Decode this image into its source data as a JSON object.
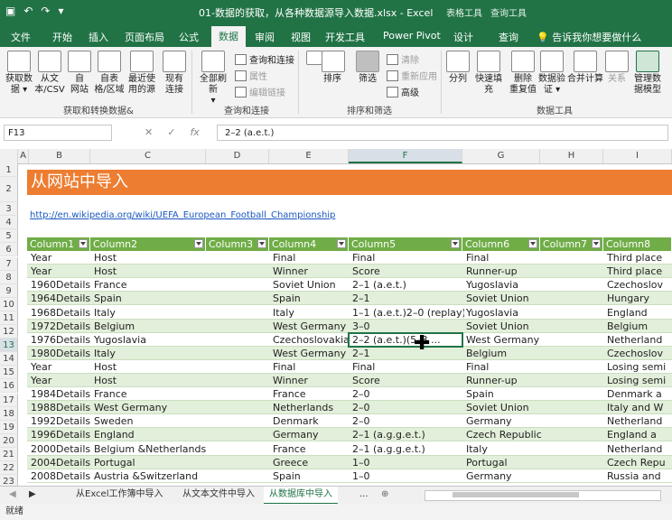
{
  "titlebar": {
    "title": "01-数据的获取，从各种数据源导入数据.xlsx  -  Excel",
    "ctx_tab1": "表格工具",
    "ctx_tab2": "查询工具"
  },
  "tabs": [
    "文件",
    "开始",
    "插入",
    "页面布局",
    "公式",
    "数据",
    "审阅",
    "视图",
    "开发工具",
    "Power Pivot",
    "设计",
    "查询"
  ],
  "tell_me": "告诉我你想要做什么",
  "ribbon": {
    "get_data": "获取数\n据 ▾",
    "from_text": "从文\n本/CSV",
    "from_web": "自\n网站",
    "from_table": "自表\n格/区域",
    "recent": "最近使\n用的源",
    "existing": "现有\n连接",
    "group_get": "获取和转换数据&",
    "refresh_all": "全部刷新\n▾",
    "queries_conn": "查询和连接",
    "properties": "属性",
    "edit_links": "编辑链接",
    "group_query": "查询和连接",
    "sort": "排序",
    "filter": "筛选",
    "clear": "清除",
    "reapply": "重新应用",
    "advanced": "高级",
    "group_sort": "排序和筛选",
    "split": "分列",
    "flash": "快速填充",
    "remove_dup": "删除\n重复值",
    "validate": "数据验\n证 ▾",
    "consolidate": "合并计算",
    "relations": "关系",
    "model": "管理数\n据模型",
    "group_tools": "数据工具"
  },
  "formula_bar": {
    "cell_ref": "F13",
    "value": "2–2 (a.e.t.)"
  },
  "columns": [
    "A",
    "B",
    "C",
    "D",
    "E",
    "F",
    "G",
    "H",
    "I"
  ],
  "rows": [
    "1",
    "2",
    "3",
    "4",
    "5",
    "6",
    "7",
    "8",
    "9",
    "10",
    "11",
    "12",
    "13",
    "14",
    "15",
    "16",
    "17",
    "18",
    "19",
    "20",
    "21",
    "22",
    "23"
  ],
  "sheet": {
    "title": "从网站中导入",
    "url": "http://en.wikipedia.org/wiki/UEFA_European_Football_Championship",
    "headers": [
      "Column1",
      "Column2",
      "Column3",
      "Column4",
      "Column5",
      "Column6",
      "Column7",
      "Column8"
    ],
    "data": [
      [
        "Year",
        "Host",
        "Final",
        "Final",
        "Final",
        "Third place"
      ],
      [
        "Year",
        "Host",
        "Winner",
        "Score",
        "Runner-up",
        "Third place"
      ],
      [
        "1960Details",
        "France",
        "Soviet Union",
        "2–1 (a.e.t.)",
        "Yugoslavia",
        "Czechoslov"
      ],
      [
        "1964Details",
        "Spain",
        "Spain",
        "2–1",
        "Soviet Union",
        "Hungary"
      ],
      [
        "1968Details",
        "Italy",
        "Italy",
        "1–1 (a.e.t.)2–0 (replay)",
        "Yugoslavia",
        "England"
      ],
      [
        "1972Details",
        "Belgium",
        "West Germany",
        "3–0",
        "Soviet Union",
        "Belgium"
      ],
      [
        "1976Details",
        "Yugoslavia",
        "Czechoslovakia",
        "2–2 (a.e.t.)(5–3 ...",
        "West Germany",
        "Netherland"
      ],
      [
        "1980Details",
        "Italy",
        "West Germany",
        "2–1",
        "Belgium",
        "Czechoslov"
      ],
      [
        "Year",
        "Host",
        "Final",
        "Final",
        "Final",
        "Losing semi"
      ],
      [
        "Year",
        "Host",
        "Winner",
        "Score",
        "Runner-up",
        "Losing semi"
      ],
      [
        "1984Details",
        "France",
        "France",
        "2–0",
        "Spain",
        "Denmark a"
      ],
      [
        "1988Details",
        "West Germany",
        "Netherlands",
        "2–0",
        "Soviet Union",
        "Italy and W"
      ],
      [
        "1992Details",
        "Sweden",
        "Denmark",
        "2–0",
        "Germany",
        "Netherland"
      ],
      [
        "1996Details",
        "England",
        "Germany",
        "2–1 (a.g.g.e.t.)",
        "Czech Republic",
        "England a"
      ],
      [
        "2000Details",
        "Belgium &Netherlands",
        "France",
        "2–1 (a.g.g.e.t.)",
        "Italy",
        "Netherland"
      ],
      [
        "2004Details",
        "Portugal",
        "Greece",
        "1–0",
        "Portugal",
        "Czech Repu"
      ],
      [
        "2008Details",
        "Austria &Switzerland",
        "Spain",
        "1–0",
        "Germany",
        "Russia and"
      ]
    ]
  },
  "sheet_tabs": [
    "从Excel工作簿中导入",
    "从文本文件中导入",
    "从数据库中导入",
    "..."
  ],
  "status": "就绪",
  "colors": {
    "accent": "#217346",
    "banner": "#ed7d31",
    "header_green": "#70ad47",
    "band": "#e2efda"
  }
}
